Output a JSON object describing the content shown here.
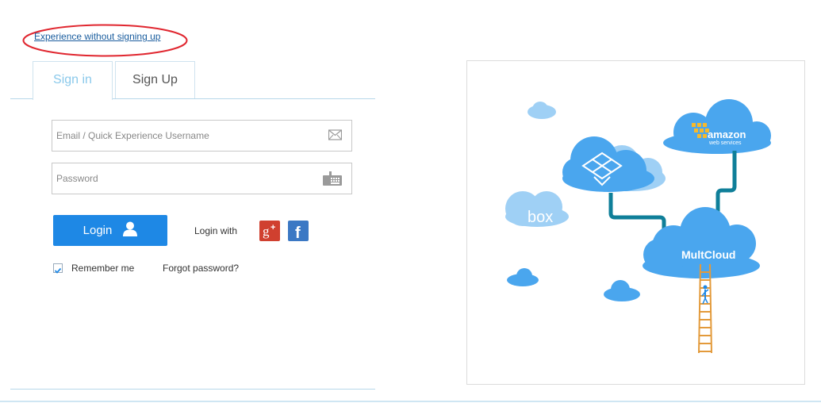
{
  "top_link": {
    "label": "Experience without signing up"
  },
  "tabs": [
    {
      "label": "Sign in",
      "active": true
    },
    {
      "label": "Sign Up",
      "active": false
    }
  ],
  "form": {
    "email": {
      "placeholder": "Email / Quick Experience Username",
      "value": "",
      "icon": "envelope-icon"
    },
    "password": {
      "placeholder": "Password",
      "value": "",
      "icon": "keyboard-icon"
    },
    "login_button": {
      "label": "Login",
      "icon": "user-icon"
    },
    "login_with_label": "Login with",
    "social": [
      {
        "name": "Google+",
        "icon": "google-plus-icon",
        "color": "#d0402f"
      },
      {
        "name": "Facebook",
        "icon": "facebook-icon",
        "color": "#3b78c4"
      }
    ],
    "remember": {
      "label": "Remember me",
      "checked": true
    },
    "forgot_label": "Forgot password?"
  },
  "illustration": {
    "labels": {
      "amazon": "amazon",
      "amazon_sub": "web services",
      "box": "box",
      "multcloud": "MultCloud"
    }
  },
  "colors": {
    "accent": "#1e88e5",
    "tab_active": "#8ac9eb",
    "link": "#1a5d9e",
    "cloud_dark": "#4aa6ee",
    "cloud_light": "#9fd0f5",
    "arrow": "#0f7f99",
    "ladder": "#e39a3a",
    "highlight": "#e0262f"
  }
}
